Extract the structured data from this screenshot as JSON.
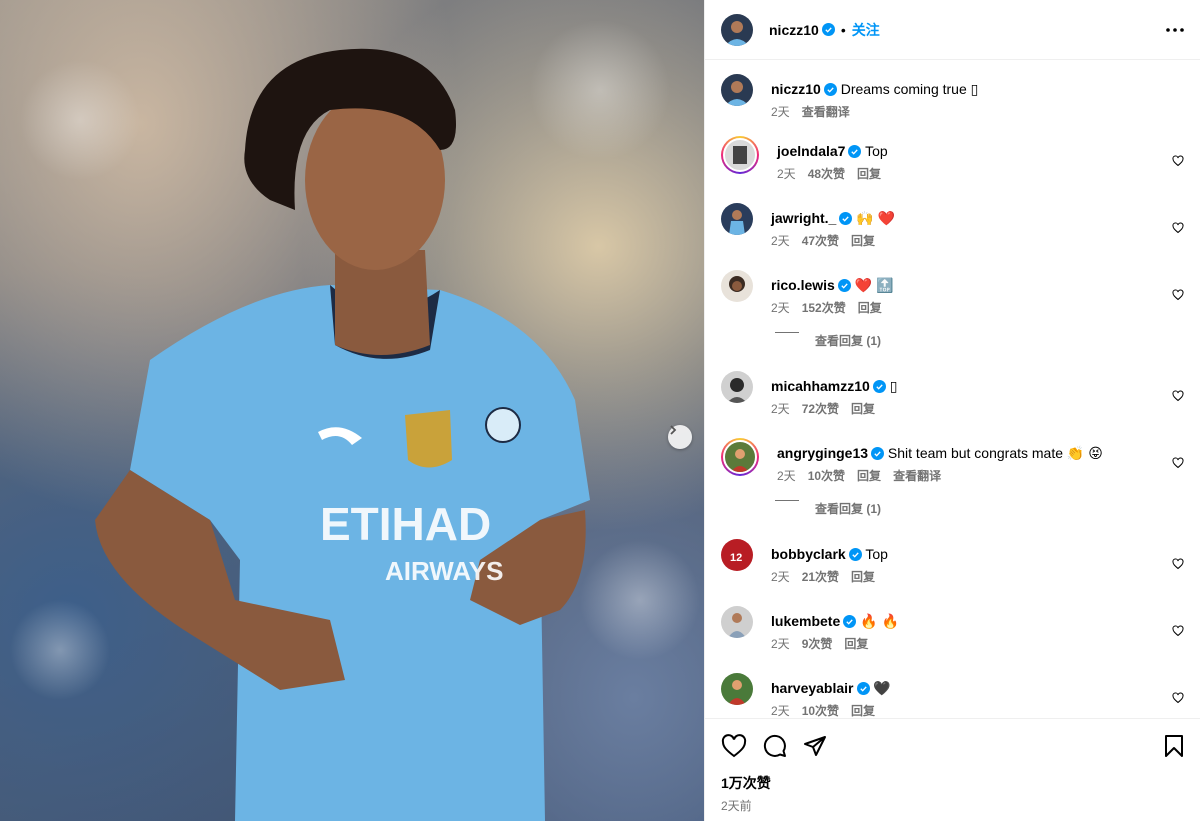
{
  "post": {
    "author": "niczz10",
    "follow_label": "关注",
    "dot": "•",
    "caption": {
      "username": "niczz10",
      "text": "Dreams coming true ▯",
      "time": "2天",
      "translate": "查看翻译"
    },
    "likes": "1万次赞",
    "date": "2天前",
    "image_description_icon": "player-photo"
  },
  "comments": [
    {
      "username": "joelndala7",
      "text": "Top",
      "time": "2天",
      "likes": "48次赞",
      "reply": "回复",
      "ring": true,
      "avatar_color": "#d9d9d9"
    },
    {
      "username": "jawright._",
      "text": "🙌 ❤️",
      "time": "2天",
      "likes": "47次赞",
      "reply": "回复",
      "ring": false,
      "avatar_color": "#2a3d5c"
    },
    {
      "username": "rico.lewis",
      "text": "❤️ 🔝",
      "time": "2天",
      "likes": "152次赞",
      "reply": "回复",
      "ring": false,
      "avatar_color": "#3b2b22",
      "replies": "查看回复 (1)"
    },
    {
      "username": "micahhamzz10",
      "text": "▯",
      "time": "2天",
      "likes": "72次赞",
      "reply": "回复",
      "ring": false,
      "avatar_color": "#4a4a4a"
    },
    {
      "username": "angryginge13",
      "text": "Shit team but congrats mate 👏 😝",
      "time": "2天",
      "likes": "10次赞",
      "reply": "回复",
      "translate": "查看翻译",
      "ring": true,
      "avatar_color": "#5b7a3a",
      "replies": "查看回复 (1)"
    },
    {
      "username": "bobbyclark",
      "text": "Top",
      "time": "2天",
      "likes": "21次赞",
      "reply": "回复",
      "ring": false,
      "avatar_color": "#b81d24"
    },
    {
      "username": "lukembete",
      "text": "🔥 🔥",
      "time": "2天",
      "likes": "9次赞",
      "reply": "回复",
      "ring": false,
      "avatar_color": "#cfcfcf"
    },
    {
      "username": "harveyablair",
      "text": "🖤",
      "time": "2天",
      "likes": "10次赞",
      "reply": "回复",
      "ring": false,
      "avatar_color": "#7a2a2a"
    }
  ],
  "colors": {
    "accent": "#0095f6",
    "verified": "#0095f6",
    "muted": "#737373"
  }
}
